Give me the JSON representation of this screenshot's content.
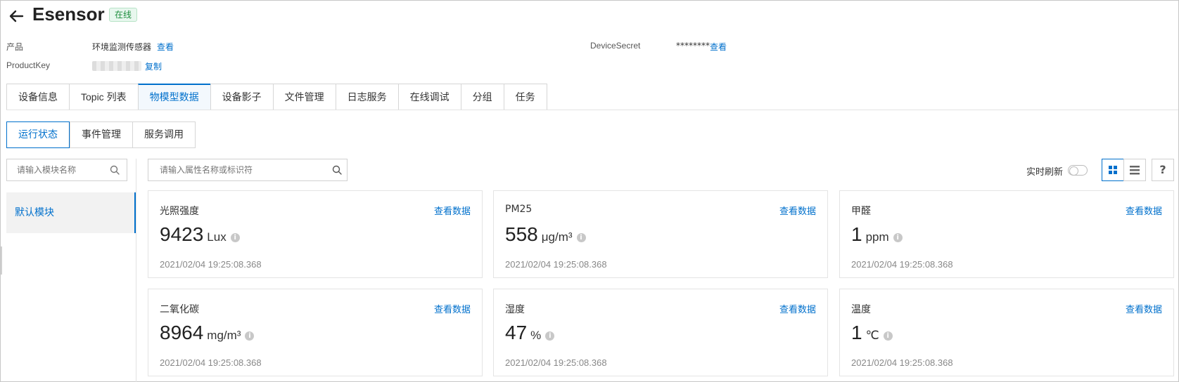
{
  "header": {
    "title": "Esensor",
    "status": "在线"
  },
  "info": {
    "product_label": "产品",
    "product_value": "环境监测传感器",
    "product_link": "查看",
    "productkey_label": "ProductKey",
    "productkey_link": "复制",
    "devicesecret_label": "DeviceSecret",
    "devicesecret_value": "********",
    "devicesecret_link": "查看"
  },
  "tabs": [
    {
      "label": "设备信息"
    },
    {
      "label": "Topic 列表"
    },
    {
      "label": "物模型数据"
    },
    {
      "label": "设备影子"
    },
    {
      "label": "文件管理"
    },
    {
      "label": "日志服务"
    },
    {
      "label": "在线调试"
    },
    {
      "label": "分组"
    },
    {
      "label": "任务"
    }
  ],
  "active_tab": "物模型数据",
  "subtabs": [
    {
      "label": "运行状态"
    },
    {
      "label": "事件管理"
    },
    {
      "label": "服务调用"
    }
  ],
  "active_subtab": "运行状态",
  "module_search": {
    "placeholder": "请输入模块名称"
  },
  "modules": [
    {
      "label": "默认模块"
    }
  ],
  "property_search": {
    "placeholder": "请输入属性名称或标识符"
  },
  "toolbar": {
    "refresh_label": "实时刷新",
    "help_label": "?"
  },
  "colors": {
    "accent": "#0070cc",
    "online_badge": "#1e8e3e"
  },
  "cards": [
    {
      "name": "光照强度",
      "value": "9423",
      "unit": "Lux",
      "link": "查看数据",
      "time": "2021/02/04 19:25:08.368"
    },
    {
      "name": "PM25",
      "value": "558",
      "unit": "μg/m³",
      "link": "查看数据",
      "time": "2021/02/04 19:25:08.368"
    },
    {
      "name": "甲醛",
      "value": "1",
      "unit": "ppm",
      "link": "查看数据",
      "time": "2021/02/04 19:25:08.368"
    },
    {
      "name": "二氧化碳",
      "value": "8964",
      "unit": "mg/m³",
      "link": "查看数据",
      "time": "2021/02/04 19:25:08.368"
    },
    {
      "name": "湿度",
      "value": "47",
      "unit": "%",
      "link": "查看数据",
      "time": "2021/02/04 19:25:08.368"
    },
    {
      "name": "温度",
      "value": "1",
      "unit": "℃",
      "link": "查看数据",
      "time": "2021/02/04 19:25:08.368"
    }
  ]
}
